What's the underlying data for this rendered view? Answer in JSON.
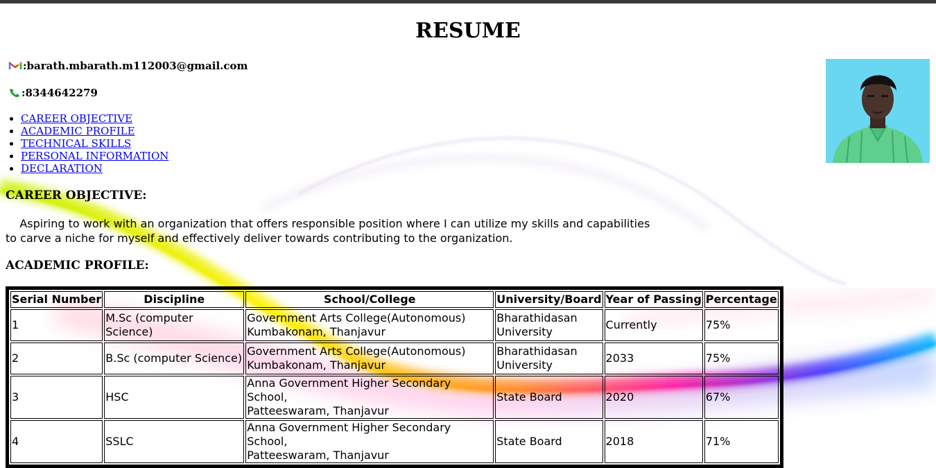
{
  "page": {
    "title": "RESUME"
  },
  "contact": {
    "email_prefix": "M",
    "email": ":barath.mbarath.m112003@gmail.com",
    "phone": ":8344642279",
    "email_icon": "gmail-icon",
    "phone_icon": "phone-icon"
  },
  "nav": {
    "items": [
      {
        "label": "CAREER OBJECTIVE"
      },
      {
        "label": "ACADEMIC PROFILE"
      },
      {
        "label": "TECHNICAL SKILLS"
      },
      {
        "label": "PERSONAL INFORMATION"
      },
      {
        "label": "DECLARATION"
      }
    ]
  },
  "career": {
    "heading": "CAREER OBJECTIVE:",
    "text_line1": "Aspiring to work with an organization that offers responsible position where I can utilize my skills and capabilities",
    "text_line2": "to carve a niche for myself and effectively deliver towards contributing to the organization."
  },
  "academic": {
    "heading": "ACADEMIC PROFILE:",
    "columns": [
      "Serial Number",
      "Discipline",
      "School/College",
      "University/Board",
      "Year of Passing",
      "Percentage"
    ],
    "rows": [
      {
        "serial": "1",
        "discipline": "M.Sc (computer Science)",
        "school_l1": "Government Arts College(Autonomous)",
        "school_l2": "Kumbakonam, Thanjavur",
        "board_l1": "Bharathidasan",
        "board_l2": "University",
        "year": "Currently",
        "percent": "75%"
      },
      {
        "serial": "2",
        "discipline": "B.Sc (computer Science)",
        "school_l1": "Government Arts College(Autonomous)",
        "school_l2": "Kumbakonam, Thanjavur",
        "board_l1": "Bharathidasan",
        "board_l2": "University",
        "year": "2033",
        "percent": "75%"
      },
      {
        "serial": "3",
        "discipline": "HSC",
        "school_l1": "Anna Government Higher Secondary School,",
        "school_l2": "Patteeswaram, Thanjavur",
        "board_l1": "State Board",
        "board_l2": "",
        "year": "2020",
        "percent": "67%"
      },
      {
        "serial": "4",
        "discipline": "SSLC",
        "school_l1": "Anna Government Higher Secondary School,",
        "school_l2": "Patteeswaram, Thanjavur",
        "board_l1": "State Board",
        "board_l2": "",
        "year": "2018",
        "percent": "71%"
      }
    ]
  },
  "colors": {
    "link": "#0000ee",
    "photo_bg": "#6ad7f2",
    "shirt": "#5fcf8d",
    "topbar": "#3a3a3a"
  }
}
